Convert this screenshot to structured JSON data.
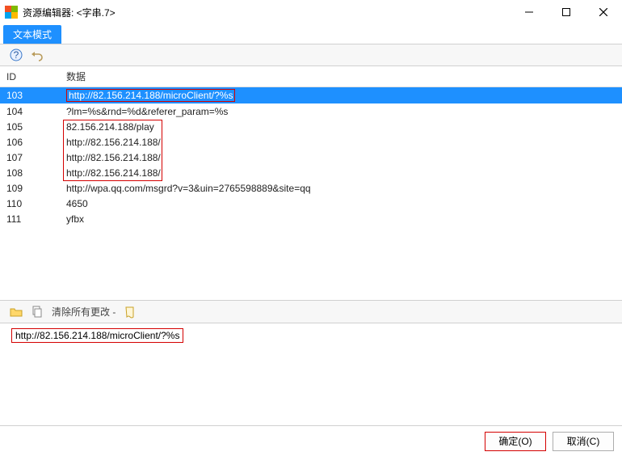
{
  "window": {
    "title": "资源编辑器: <字串.7>"
  },
  "tab": {
    "label": "文本模式"
  },
  "table": {
    "headers": {
      "id": "ID",
      "data": "数据"
    },
    "rows": [
      {
        "id": "103",
        "data": "http://82.156.214.188/microClient/?%s",
        "selected": true,
        "box": true
      },
      {
        "id": "104",
        "data": "?lm=%s&rnd=%d&referer_param=%s"
      },
      {
        "id": "105",
        "data": "82.156.214.188/play"
      },
      {
        "id": "106",
        "data": "http://82.156.214.188/"
      },
      {
        "id": "107",
        "data": "http://82.156.214.188/"
      },
      {
        "id": "108",
        "data": "http://82.156.214.188/"
      },
      {
        "id": "109",
        "data": "http://wpa.qq.com/msgrd?v=3&uin=2765598889&site=qq"
      },
      {
        "id": "110",
        "data": "4650"
      },
      {
        "id": "111",
        "data": "yfbx"
      }
    ],
    "group_box": {
      "from_id": "105",
      "to_id": "108"
    }
  },
  "toolbar2": {
    "clear_label": "清除所有更改 -"
  },
  "editor": {
    "text": "http://82.156.214.188/microClient/?%s"
  },
  "footer": {
    "ok": "确定(O)",
    "cancel": "取消(C)"
  }
}
